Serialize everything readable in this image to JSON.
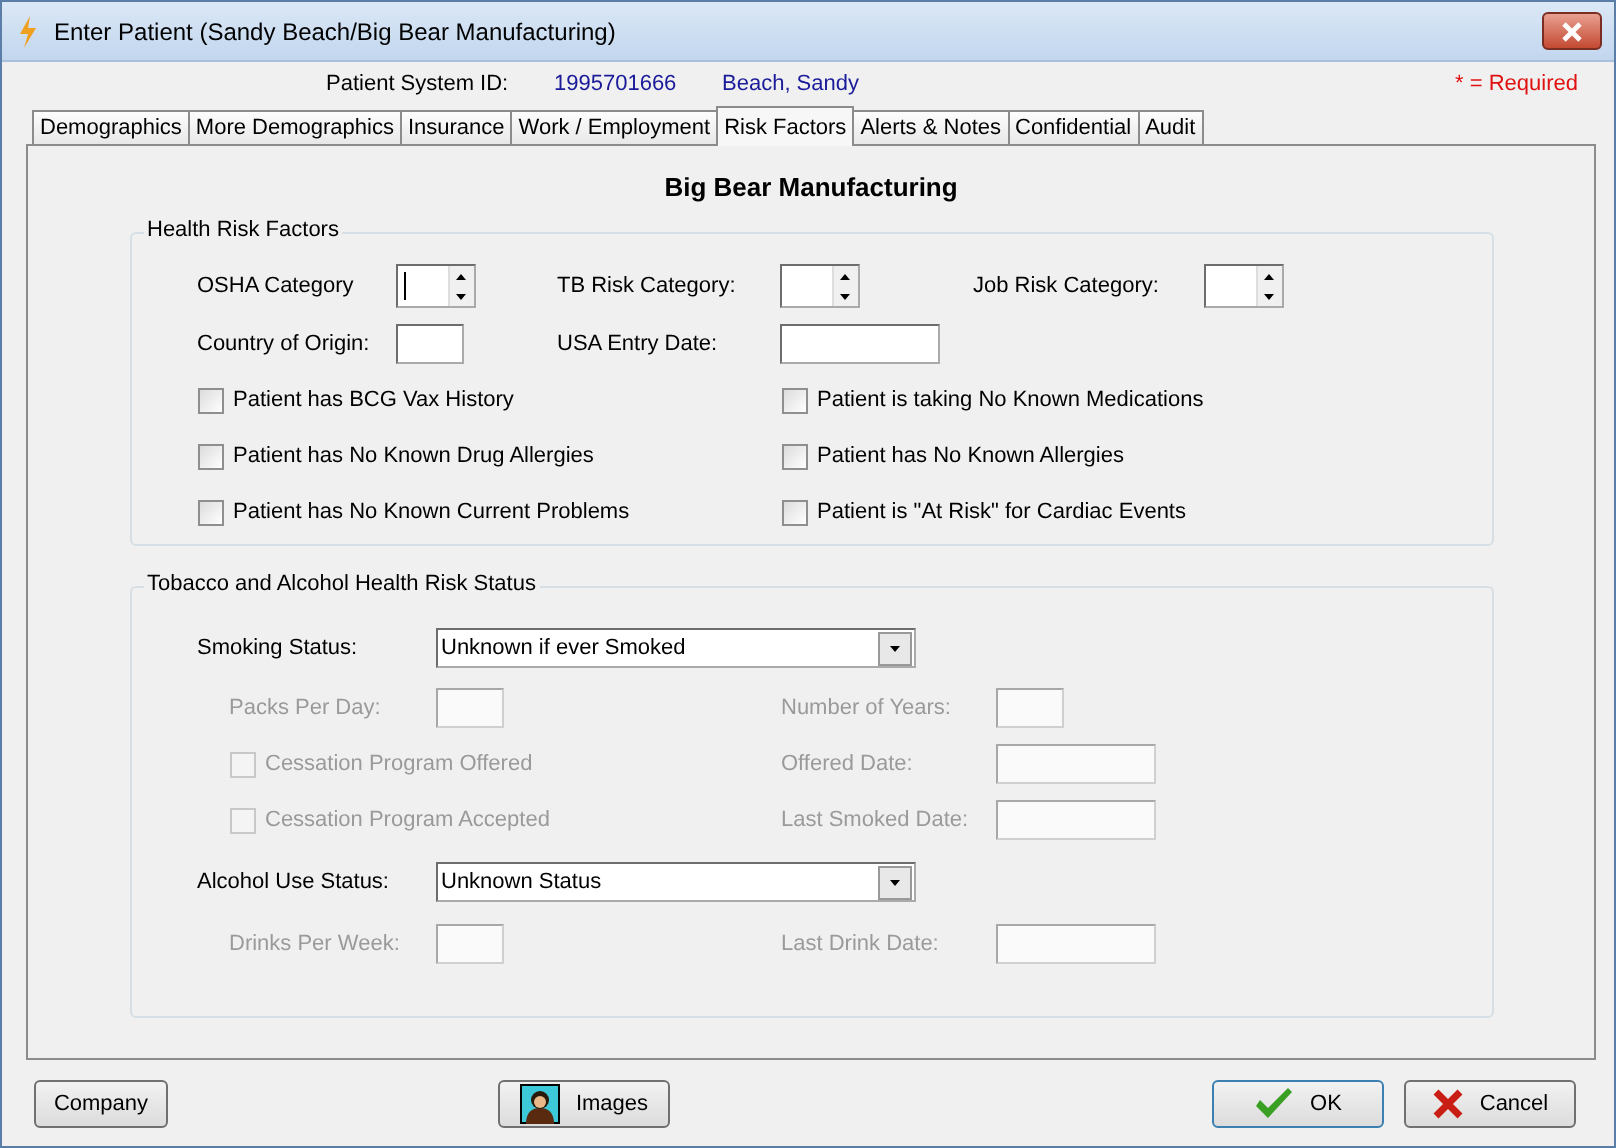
{
  "window": {
    "title": "Enter Patient (Sandy Beach/Big Bear Manufacturing)"
  },
  "header": {
    "id_label": "Patient System ID:",
    "id_value": "1995701666",
    "patient_name": "Beach, Sandy",
    "required_note": "* = Required"
  },
  "tabs": [
    {
      "label": "Demographics",
      "selected": false
    },
    {
      "label": "More Demographics",
      "selected": false
    },
    {
      "label": "Insurance",
      "selected": false
    },
    {
      "label": "Work / Employment",
      "selected": false
    },
    {
      "label": "Risk Factors",
      "selected": true
    },
    {
      "label": "Alerts & Notes",
      "selected": false
    },
    {
      "label": "Confidential",
      "selected": false
    },
    {
      "label": "Audit",
      "selected": false
    }
  ],
  "company_name": "Big Bear Manufacturing",
  "health_risk": {
    "title": "Health Risk Factors",
    "spinners": [
      {
        "label": "OSHA Category",
        "focused": true
      },
      {
        "label": "TB Risk Category:",
        "focused": false
      },
      {
        "label": "Job Risk Category:",
        "focused": false
      }
    ],
    "fields": [
      {
        "label": "Country of Origin:"
      },
      {
        "label": "USA Entry Date:"
      }
    ],
    "checkboxes": [
      {
        "label": "Patient has BCG Vax History",
        "checked": false
      },
      {
        "label": "Patient is taking No Known Medications",
        "checked": false
      },
      {
        "label": "Patient has No Known Drug Allergies",
        "checked": false
      },
      {
        "label": "Patient has No Known Allergies",
        "checked": false
      },
      {
        "label": "Patient has No Known Current Problems",
        "checked": false
      },
      {
        "label": "Patient is \"At Risk\" for Cardiac Events",
        "checked": false
      }
    ]
  },
  "tobacco": {
    "title": "Tobacco and Alcohol Health Risk Status",
    "rows": [
      {
        "kind": "select",
        "label": "Smoking Status:",
        "value": "Unknown if ever Smoked",
        "disabled": false
      },
      {
        "kind": "pair",
        "left": {
          "kind": "field",
          "label": "Packs Per Day:",
          "disabled": true
        },
        "right": {
          "label": "Number of Years:",
          "disabled": true
        }
      },
      {
        "kind": "pair",
        "left": {
          "kind": "checkbox",
          "label": "Cessation Program Offered",
          "checked": false,
          "disabled": true
        },
        "right": {
          "label": "Offered Date:",
          "disabled": true
        }
      },
      {
        "kind": "pair",
        "left": {
          "kind": "checkbox",
          "label": "Cessation Program Accepted",
          "checked": false,
          "disabled": true
        },
        "right": {
          "label": "Last Smoked Date:",
          "disabled": true
        }
      },
      {
        "kind": "select",
        "label": "Alcohol Use Status:",
        "value": "Unknown Status",
        "disabled": false
      },
      {
        "kind": "pair",
        "left": {
          "kind": "field",
          "label": "Drinks Per Week:",
          "disabled": true
        },
        "right": {
          "label": "Last Drink Date:",
          "disabled": true
        }
      }
    ]
  },
  "buttons": [
    {
      "kind": "company",
      "label": "Company"
    },
    {
      "kind": "images",
      "label": "Images"
    },
    {
      "kind": "ok",
      "label": "OK",
      "default": true
    },
    {
      "kind": "cancel",
      "label": "Cancel",
      "default": false
    }
  ]
}
